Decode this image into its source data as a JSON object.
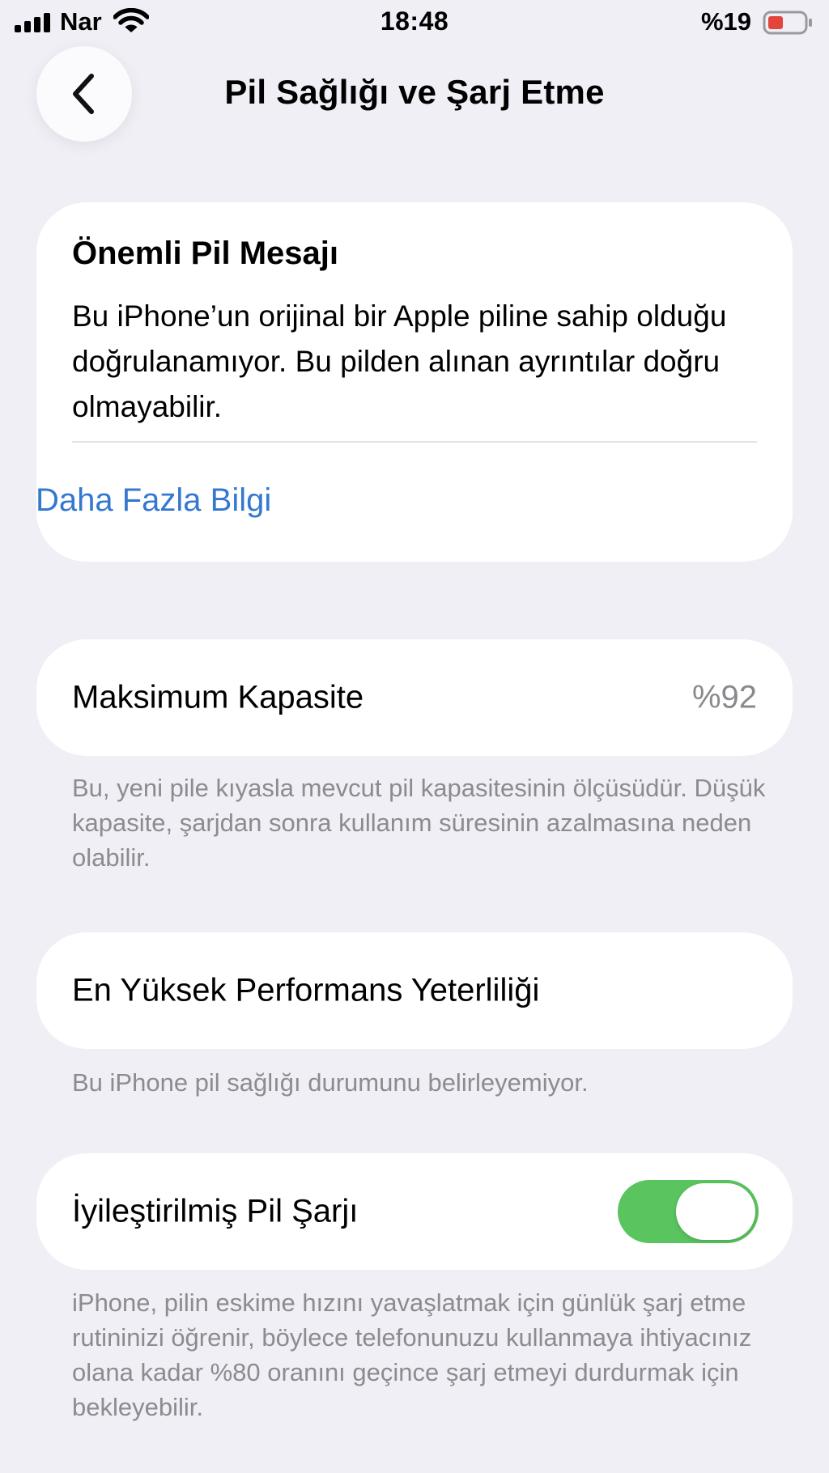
{
  "status_bar": {
    "carrier": "Nar",
    "time": "18:48",
    "battery_percent": "%19",
    "battery_level": 0.19,
    "battery_color": "#e2453c",
    "icons": [
      "signal-icon",
      "wifi-icon",
      "battery-icon"
    ]
  },
  "header": {
    "title": "Pil Sağlığı ve Şarj Etme",
    "back_icon": "chevron-left-icon"
  },
  "message_card": {
    "title": "Önemli Pil Mesajı",
    "body": "Bu iPhone’un orijinal bir Apple piline sahip olduğu doğrulanamıyor. Bu pilden alınan ayrıntılar doğru olmayabilir.",
    "link": "Daha Fazla Bilgi"
  },
  "capacity": {
    "label": "Maksimum Kapasite",
    "value": "%92",
    "note": "Bu, yeni pile kıyasla mevcut pil kapasitesinin ölçüsüdür. Düşük kapasite, şarjdan sonra kullanım süresinin azalmasına neden olabilir."
  },
  "performance": {
    "label": "En Yüksek Performans Yeterliliği",
    "note": "Bu iPhone pil sağlığı durumunu belirleyemiyor."
  },
  "optimized_charging": {
    "label": "İyileştirilmiş Pil Şarjı",
    "enabled": true,
    "toggle_color": "#5ac45f",
    "note": "iPhone, pilin eskime hızını yavaşlatmak için günlük şarj etme rutininizi öğrenir, böylece telefonunuzu kullanmaya ihtiyacınız olana kadar %80 oranını geçince şarj etmeyi durdurmak için bekleyebilir."
  },
  "colors": {
    "background": "#f0eff5",
    "link": "#3478d0",
    "secondary_text": "#8b8b90"
  }
}
